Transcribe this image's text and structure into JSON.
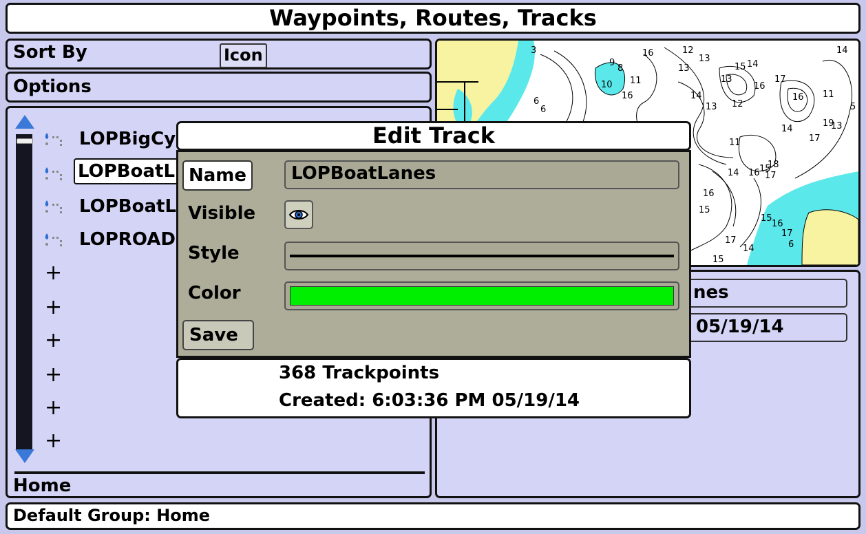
{
  "title": "Waypoints, Routes, Tracks",
  "sort": {
    "label": "Sort By",
    "value": "Icon"
  },
  "options": {
    "label": "Options"
  },
  "list": {
    "items": [
      {
        "label": "LOPBigCy",
        "icon": "track-icon",
        "selected": false
      },
      {
        "label": "LOPBoatL",
        "icon": "track-icon",
        "selected": true
      },
      {
        "label": "LOPBoatL",
        "icon": "track-icon",
        "selected": false
      },
      {
        "label": "LOPROAD",
        "icon": "track-icon",
        "selected": false
      }
    ],
    "empty_slot": "+",
    "empty_slot_count": 6,
    "group": "Home"
  },
  "details": {
    "name_partial": "nes",
    "date_partial": "05/19/14"
  },
  "map": {
    "depth_labels": [
      "3",
      "9",
      "8",
      "10",
      "11",
      "16",
      "12",
      "13",
      "15",
      "14",
      "17",
      "6",
      "18",
      "19"
    ]
  },
  "status": "Default Group: Home",
  "dialog": {
    "title": "Edit Track",
    "name_label": "Name",
    "name_value": "LOPBoatLanes",
    "visible_label": "Visible",
    "visible_icon": "eye-icon",
    "style_label": "Style",
    "color_label": "Color",
    "color_value": "#00ee00",
    "save_label": "Save",
    "trackpoints": "368 Trackpoints",
    "created": "Created: 6:03:36 PM 05/19/14"
  },
  "colors": {
    "panel": "#d4d4f6",
    "dialog": "#adad9a",
    "water": "#5be8ea",
    "land": "#f7f3a0",
    "scroll_arrow": "#3a79d8"
  }
}
